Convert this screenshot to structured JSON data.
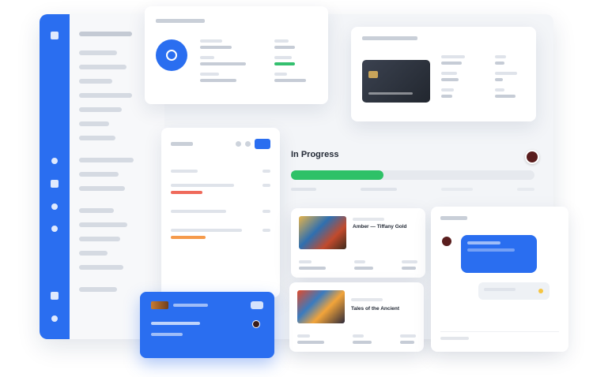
{
  "progress": {
    "title": "In Progress",
    "percent": 38
  },
  "books": [
    {
      "title": "Amber — Tiffany Gold"
    },
    {
      "title": "Tales of the Ancient"
    }
  ],
  "colors": {
    "accent": "#2a6ef0",
    "success": "#2ec167",
    "danger": "#ef6a5b",
    "warning": "#f59a4b"
  }
}
